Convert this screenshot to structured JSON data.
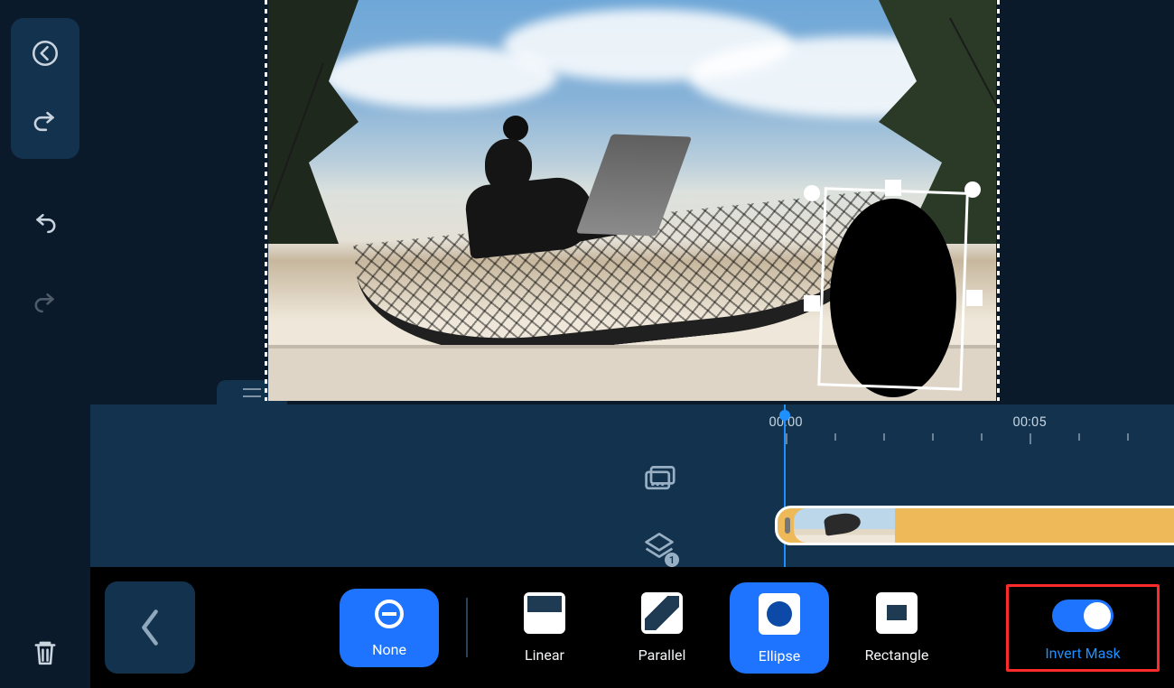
{
  "sidebar": {
    "back_icon": "chevron-left-circle",
    "revert_icon": "revert",
    "undo_icon": "undo",
    "redo_icon": "redo",
    "delete_icon": "trash"
  },
  "preview": {
    "mask_shape": "ellipse",
    "mask_selected": true
  },
  "timeline": {
    "labels": [
      "00:00",
      "00:05"
    ],
    "tracks_icon": "frames",
    "layers_icon": "layers",
    "layers_badge": "1",
    "playhead_time": "00:00"
  },
  "toolbar": {
    "back_label": "back",
    "items": [
      {
        "id": "none",
        "label": "None",
        "selected": true
      },
      {
        "id": "linear",
        "label": "Linear",
        "selected": false
      },
      {
        "id": "parallel",
        "label": "Parallel",
        "selected": false
      },
      {
        "id": "ellipse",
        "label": "Ellipse",
        "selected": true
      },
      {
        "id": "rectangle",
        "label": "Rectangle",
        "selected": false
      }
    ],
    "invert": {
      "label": "Invert Mask",
      "on": true
    }
  }
}
